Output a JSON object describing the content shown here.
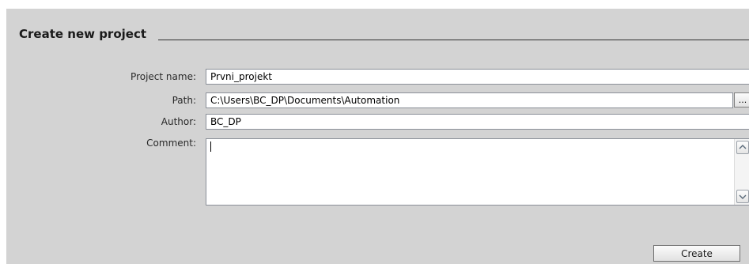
{
  "section": {
    "title": "Create new project"
  },
  "form": {
    "project_name": {
      "label": "Project name:",
      "value": "Prvni_projekt"
    },
    "path": {
      "label": "Path:",
      "value": "C:\\Users\\BC_DP\\Documents\\Automation",
      "browse_label": "..."
    },
    "author": {
      "label": "Author:",
      "value": "BC_DP"
    },
    "comment": {
      "label": "Comment:",
      "value": ""
    }
  },
  "scrollbar": {
    "up_icon": "chevron-up-icon",
    "down_icon": "chevron-down-icon"
  },
  "actions": {
    "create_label": "Create"
  },
  "colors": {
    "panel_background": "#d3d3d3",
    "field_border": "#8a8f98",
    "field_background": "#ffffff"
  }
}
